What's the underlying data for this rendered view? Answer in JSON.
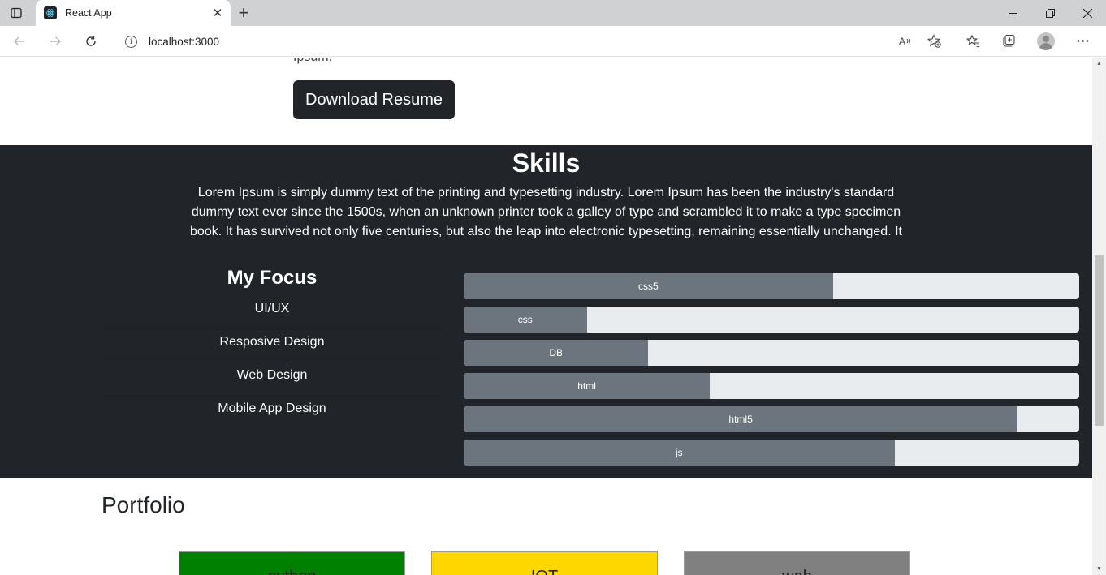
{
  "browser": {
    "tab_title": "React App",
    "url": "localhost:3000",
    "tab_close_glyph": "✕",
    "new_tab_glyph": "+",
    "icons": [
      "sidebar-icon",
      "react-favicon-icon",
      "back-icon",
      "forward-icon",
      "refresh-icon",
      "info-icon",
      "read-aloud-icon",
      "add-favorite-icon",
      "favorites-icon",
      "collections-icon",
      "profile-icon",
      "more-icon",
      "minimize-icon",
      "restore-icon",
      "close-window-icon"
    ]
  },
  "hero": {
    "cut_text": "Ipsum.",
    "download_label": "Download Resume"
  },
  "skills": {
    "title": "Skills",
    "lead": "Lorem Ipsum is simply dummy text of the printing and typesetting industry. Lorem Ipsum has been the industry's standard dummy text ever since the 1500s, when an unknown printer took a galley of type and scrambled it to make a type specimen book. It has survived not only five centuries, but also the leap into electronic typesetting, remaining essentially unchanged. It",
    "focus_title": "My Focus",
    "focus_items": [
      "UI/UX",
      "Resposive Design",
      "Web Design",
      "Mobile App Design"
    ],
    "bars": [
      {
        "label": "css5",
        "percent": 60
      },
      {
        "label": "css",
        "percent": 20
      },
      {
        "label": "DB",
        "percent": 30
      },
      {
        "label": "html",
        "percent": 40
      },
      {
        "label": "html5",
        "percent": 90
      },
      {
        "label": "js",
        "percent": 70
      }
    ],
    "colors": {
      "section_bg": "#212529",
      "bar_fill": "#6c757d",
      "bar_track": "#e9ecef"
    }
  },
  "portfolio": {
    "title": "Portfolio",
    "cards": [
      {
        "label": "python",
        "color": "#008000"
      },
      {
        "label": "IOT",
        "color": "#ffd700"
      },
      {
        "label": "web",
        "color": "#808080"
      }
    ]
  }
}
